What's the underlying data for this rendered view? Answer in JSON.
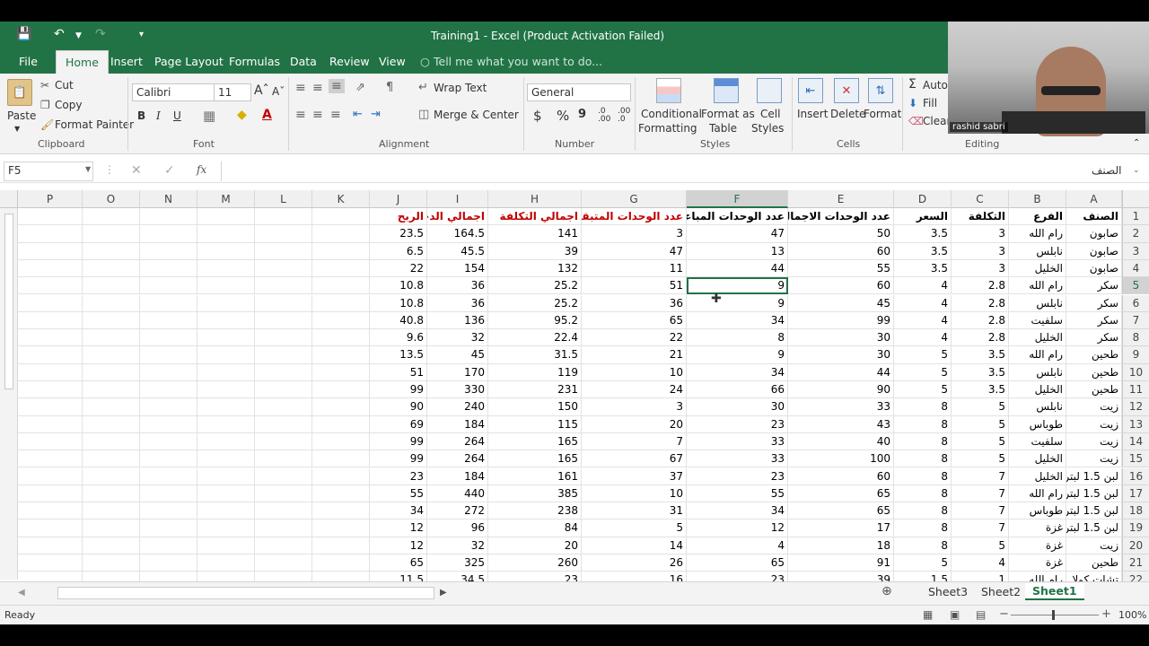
{
  "window": {
    "title": "Training1 - Excel (Product Activation Failed)"
  },
  "menu": [
    "File",
    "Home",
    "Insert",
    "Page Layout",
    "Formulas",
    "Data",
    "Review",
    "View"
  ],
  "tell_me": "Tell me what you want to do...",
  "ribbon": {
    "clipboard": {
      "paste": "Paste",
      "cut": "Cut",
      "copy": "Copy",
      "format_painter": "Format Painter",
      "group": "Clipboard"
    },
    "font": {
      "name": "Calibri",
      "size": "11",
      "bold": "B",
      "italic": "I",
      "underline": "U",
      "group": "Font"
    },
    "alignment": {
      "wrap": "Wrap Text",
      "merge": "Merge & Center",
      "group": "Alignment"
    },
    "number": {
      "format": "General",
      "currency": "$",
      "percent": "%",
      "comma": "9",
      "group": "Number"
    },
    "styles": {
      "conditional": "Conditional",
      "conditional2": "Formatting",
      "format_table": "Format as",
      "format_table2": "Table",
      "cell_styles": "Cell",
      "cell_styles2": "Styles",
      "group": "Styles"
    },
    "cells": {
      "insert": "Insert",
      "delete": "Delete",
      "format": "Format",
      "group": "Cells"
    },
    "editing": {
      "autosum": "AutoS",
      "fill": "Fill",
      "clear": "Clear",
      "group": "Editing"
    }
  },
  "video_overlay": {
    "name": "rashid sabri"
  },
  "formula_bar": {
    "name_box": "F5",
    "fx": "fx",
    "content": "",
    "right_text": "الصنف"
  },
  "columns": [
    "P",
    "O",
    "N",
    "M",
    "L",
    "K",
    "J",
    "I",
    "H",
    "G",
    "F",
    "E",
    "D",
    "C",
    "B",
    "A"
  ],
  "selected_column": "F",
  "selected_row": "5",
  "rows": [
    {
      "n": "1",
      "A": "الصنف",
      "B": "الفرع",
      "C": "التكلفة",
      "D": "السعر",
      "E": "عدد الوحدات الاجمالي",
      "F": "عدد الوحدات المباعة",
      "G": "عدد الوحدات المتبقية",
      "H": "اجمالي التكلفة",
      "I": "اجمالي الدخل",
      "J": "الربح"
    },
    {
      "n": "2",
      "A": "صابون",
      "B": "رام الله",
      "C": "3",
      "D": "3.5",
      "E": "50",
      "F": "47",
      "G": "3",
      "H": "141",
      "I": "164.5",
      "J": "23.5"
    },
    {
      "n": "3",
      "A": "صابون",
      "B": "نابلس",
      "C": "3",
      "D": "3.5",
      "E": "60",
      "F": "13",
      "G": "47",
      "H": "39",
      "I": "45.5",
      "J": "6.5"
    },
    {
      "n": "4",
      "A": "صابون",
      "B": "الخليل",
      "C": "3",
      "D": "3.5",
      "E": "55",
      "F": "44",
      "G": "11",
      "H": "132",
      "I": "154",
      "J": "22"
    },
    {
      "n": "5",
      "A": "سكر",
      "B": "رام الله",
      "C": "2.8",
      "D": "4",
      "E": "60",
      "F": "9",
      "G": "51",
      "H": "25.2",
      "I": "36",
      "J": "10.8"
    },
    {
      "n": "6",
      "A": "سكر",
      "B": "نابلس",
      "C": "2.8",
      "D": "4",
      "E": "45",
      "F": "9",
      "G": "36",
      "H": "25.2",
      "I": "36",
      "J": "10.8"
    },
    {
      "n": "7",
      "A": "سكر",
      "B": "سلفيت",
      "C": "2.8",
      "D": "4",
      "E": "99",
      "F": "34",
      "G": "65",
      "H": "95.2",
      "I": "136",
      "J": "40.8"
    },
    {
      "n": "8",
      "A": "سكر",
      "B": "الخليل",
      "C": "2.8",
      "D": "4",
      "E": "30",
      "F": "8",
      "G": "22",
      "H": "22.4",
      "I": "32",
      "J": "9.6"
    },
    {
      "n": "9",
      "A": "طحين",
      "B": "رام الله",
      "C": "3.5",
      "D": "5",
      "E": "30",
      "F": "9",
      "G": "21",
      "H": "31.5",
      "I": "45",
      "J": "13.5"
    },
    {
      "n": "10",
      "A": "طحين",
      "B": "نابلس",
      "C": "3.5",
      "D": "5",
      "E": "44",
      "F": "34",
      "G": "10",
      "H": "119",
      "I": "170",
      "J": "51"
    },
    {
      "n": "11",
      "A": "طحين",
      "B": "الخليل",
      "C": "3.5",
      "D": "5",
      "E": "90",
      "F": "66",
      "G": "24",
      "H": "231",
      "I": "330",
      "J": "99"
    },
    {
      "n": "12",
      "A": "زيت",
      "B": "نابلس",
      "C": "5",
      "D": "8",
      "E": "33",
      "F": "30",
      "G": "3",
      "H": "150",
      "I": "240",
      "J": "90"
    },
    {
      "n": "13",
      "A": "زيت",
      "B": "طوباس",
      "C": "5",
      "D": "8",
      "E": "43",
      "F": "23",
      "G": "20",
      "H": "115",
      "I": "184",
      "J": "69"
    },
    {
      "n": "14",
      "A": "زيت",
      "B": "سلفيت",
      "C": "5",
      "D": "8",
      "E": "40",
      "F": "33",
      "G": "7",
      "H": "165",
      "I": "264",
      "J": "99"
    },
    {
      "n": "15",
      "A": "زيت",
      "B": "الخليل",
      "C": "5",
      "D": "8",
      "E": "100",
      "F": "33",
      "G": "67",
      "H": "165",
      "I": "264",
      "J": "99"
    },
    {
      "n": "16",
      "A": "لبن 1.5 لبتر",
      "B": "الخليل",
      "C": "7",
      "D": "8",
      "E": "60",
      "F": "23",
      "G": "37",
      "H": "161",
      "I": "184",
      "J": "23"
    },
    {
      "n": "17",
      "A": "لبن 1.5 لبتر",
      "B": "رام الله",
      "C": "7",
      "D": "8",
      "E": "65",
      "F": "55",
      "G": "10",
      "H": "385",
      "I": "440",
      "J": "55"
    },
    {
      "n": "18",
      "A": "لبن 1.5 لبتر",
      "B": "طوباس",
      "C": "7",
      "D": "8",
      "E": "65",
      "F": "34",
      "G": "31",
      "H": "238",
      "I": "272",
      "J": "34"
    },
    {
      "n": "19",
      "A": "لبن 1.5 لبتر",
      "B": "غزة",
      "C": "7",
      "D": "8",
      "E": "17",
      "F": "12",
      "G": "5",
      "H": "84",
      "I": "96",
      "J": "12"
    },
    {
      "n": "20",
      "A": "زيت",
      "B": "غزة",
      "C": "5",
      "D": "8",
      "E": "18",
      "F": "4",
      "G": "14",
      "H": "20",
      "I": "32",
      "J": "12"
    },
    {
      "n": "21",
      "A": "طحين",
      "B": "غزة",
      "C": "4",
      "D": "5",
      "E": "91",
      "F": "65",
      "G": "26",
      "H": "260",
      "I": "325",
      "J": "65"
    },
    {
      "n": "22",
      "A": "تشات كولا",
      "B": "رام الله",
      "C": "1",
      "D": "1.5",
      "E": "39",
      "F": "23",
      "G": "16",
      "H": "23",
      "I": "34.5",
      "J": "11.5"
    }
  ],
  "sheets": [
    "Sheet3",
    "Sheet2",
    "Sheet1"
  ],
  "active_sheet": "Sheet1",
  "status": {
    "ready": "Ready",
    "zoom": "100%"
  }
}
